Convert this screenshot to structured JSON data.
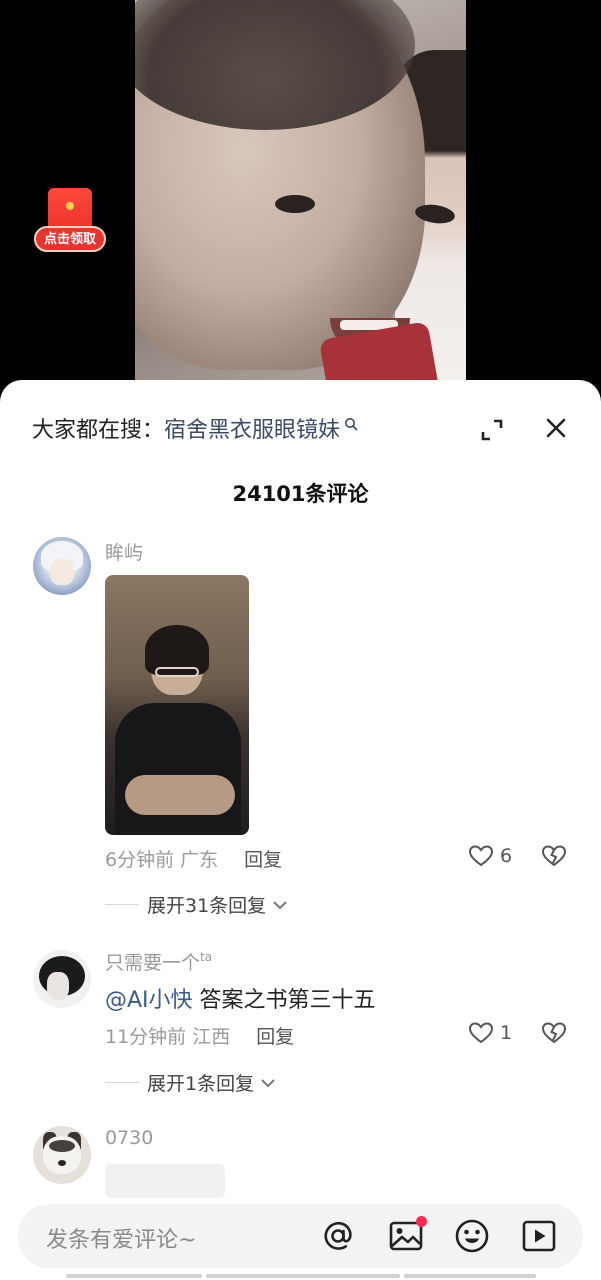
{
  "video": {
    "red_packet_label": "点击领取"
  },
  "sheet": {
    "search_prefix": "大家都在搜：",
    "search_term": "宿舍黑衣服眼镜妹",
    "comment_count": "24101条评论"
  },
  "comments": [
    {
      "username": "眸屿",
      "time": "6分钟前",
      "region": "广东",
      "reply_label": "回复",
      "likes": "6",
      "expand_label": "展开31条回复"
    },
    {
      "username": "只需要一个",
      "username_sup": "ta",
      "mention": "@AI小快",
      "text": " 答案之书第三十五",
      "time": "11分钟前",
      "region": "江西",
      "reply_label": "回复",
      "likes": "1",
      "expand_label": "展开1条回复"
    },
    {
      "username": "0730"
    }
  ],
  "input": {
    "placeholder": "发条有爱评论~"
  },
  "icons": {
    "search": "search-icon",
    "expand": "expand-icon",
    "close": "close-icon",
    "like": "heart-icon",
    "dislike": "broken-heart-icon",
    "at": "at-icon",
    "image": "image-icon",
    "emoji": "emoji-icon",
    "video": "video-icon"
  },
  "colors": {
    "accent": "#fe2c55",
    "search_term": "#3d4b66",
    "mention": "#3d5a88"
  }
}
